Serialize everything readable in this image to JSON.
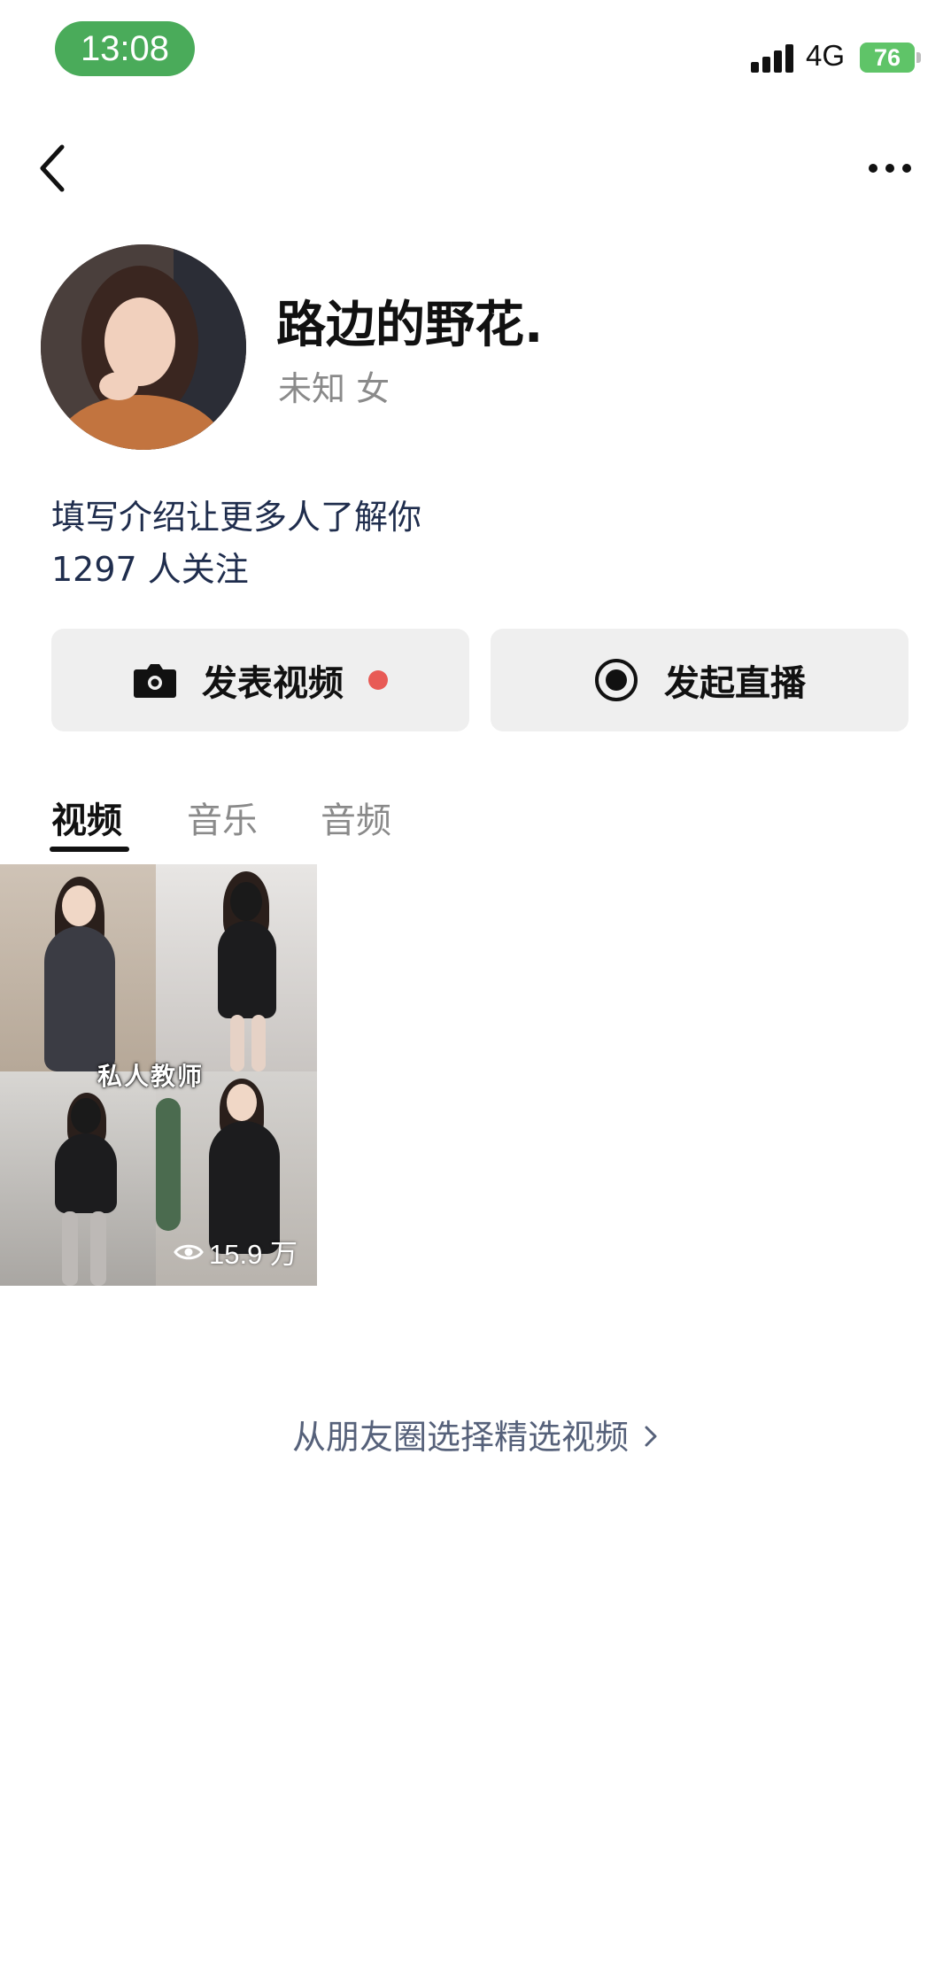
{
  "status_bar": {
    "time": "13:08",
    "network": "4G",
    "battery": "76"
  },
  "nav": {
    "back_icon": "chevron-left-icon",
    "more_icon": "more-dots-icon"
  },
  "profile": {
    "name": "路边的野花.",
    "meta": "未知  女",
    "intro": "填写介绍让更多人了解你",
    "follow_count": "1297 人关注"
  },
  "actions": {
    "post_label": "发表视频",
    "post_icon": "camera-icon",
    "live_label": "发起直播",
    "live_icon": "record-icon"
  },
  "tabs": [
    {
      "label": "视频",
      "active": true
    },
    {
      "label": "音乐",
      "active": false
    },
    {
      "label": "音频",
      "active": false
    }
  ],
  "videos": [
    {
      "caption": "私人教师",
      "views": "15.9 万"
    }
  ],
  "select_link": "从朋友圈选择精选视频",
  "colors": {
    "accent_green": "#4aab5a",
    "link_blue": "#1f2d4d",
    "dot_red": "#e85a55"
  }
}
